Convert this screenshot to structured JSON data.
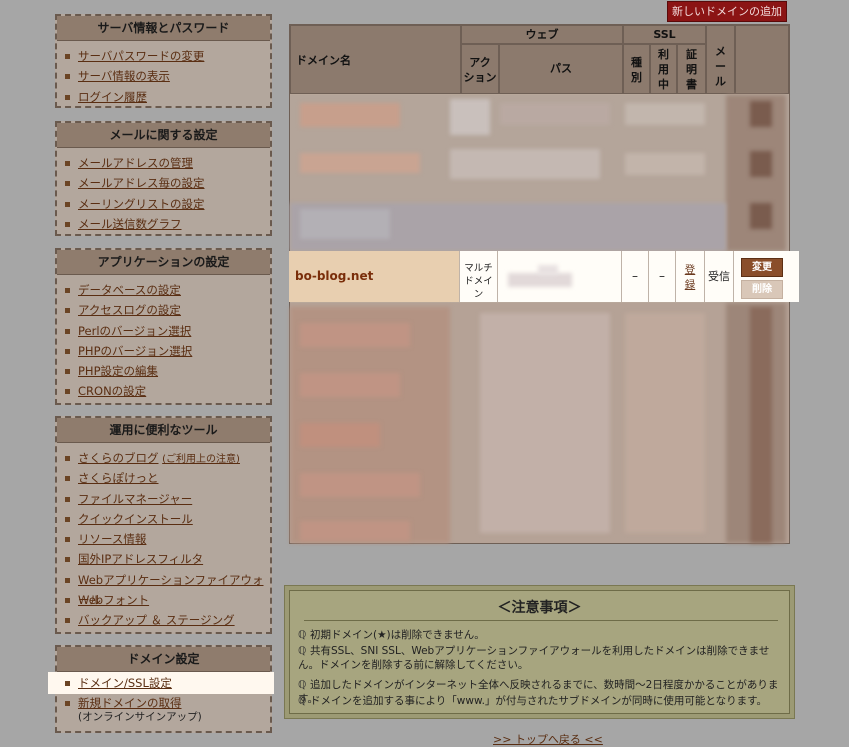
{
  "sidebar": {
    "sections": [
      {
        "title": "サーバ情報とパスワード",
        "items": [
          "サーバパスワードの変更",
          "サーバ情報の表示",
          "ログイン履歴"
        ]
      },
      {
        "title": "メールに関する設定",
        "items": [
          "メールアドレスの管理",
          "メールアドレス毎の設定",
          "メーリングリストの設定",
          "メール送信数グラフ"
        ]
      },
      {
        "title": "アプリケーションの設定",
        "items": [
          "データベースの設定",
          "アクセスログの設定",
          "Perlのバージョン選択",
          "PHPのバージョン選択",
          "PHP設定の編集",
          "CRONの設定"
        ]
      },
      {
        "title": "運用に便利なツール",
        "items": [
          "さくらのブログ",
          "さくらぽけっと",
          "ファイルマネージャー",
          "クイックインストール",
          "リソース情報",
          "国外IPアドレスフィルタ",
          "Webアプリケーションファイアウォール",
          "Webフォント",
          "バックアップ ＆ ステージング"
        ],
        "blog_note": "(ご利用上の注意)"
      },
      {
        "title": "ドメイン設定",
        "items": [
          "ドメイン/SSL設定",
          "新規ドメインの取得"
        ],
        "sub_note": "(オンラインサインアップ)"
      }
    ]
  },
  "header": {
    "new_domain_button": "新しいドメインの追加"
  },
  "table": {
    "headers": {
      "domain": "ドメイン名",
      "web": "ウェブ",
      "action": "アクション",
      "path": "パス",
      "ssl": "SSL",
      "type": "種別",
      "usage": "利用中",
      "cert": "証明書",
      "mail": "メール"
    },
    "highlight_row": {
      "domain": "bo-blog.net",
      "action": "マルチドメイン",
      "type": "–",
      "usage": "–",
      "cert": "登録",
      "mail": "受信",
      "edit_button": "変更",
      "delete_button": "削除"
    }
  },
  "notice": {
    "title": "＜注意事項＞",
    "items": [
      "初期ドメイン(★)は削除できません。",
      "共有SSL、SNI SSL、Webアプリケーションファイアウォールを利用したドメインは削除できません。ドメインを削除する前に解除してください。",
      "追加したドメインがインターネット全体へ反映されるまでに、数時間〜2日程度かかることがあります。",
      "ドメインを追加する事により「www.」が付与されたサブドメインが同時に使用可能となります。"
    ]
  },
  "footer": {
    "top_link": ">> トップへ戻る <<"
  }
}
